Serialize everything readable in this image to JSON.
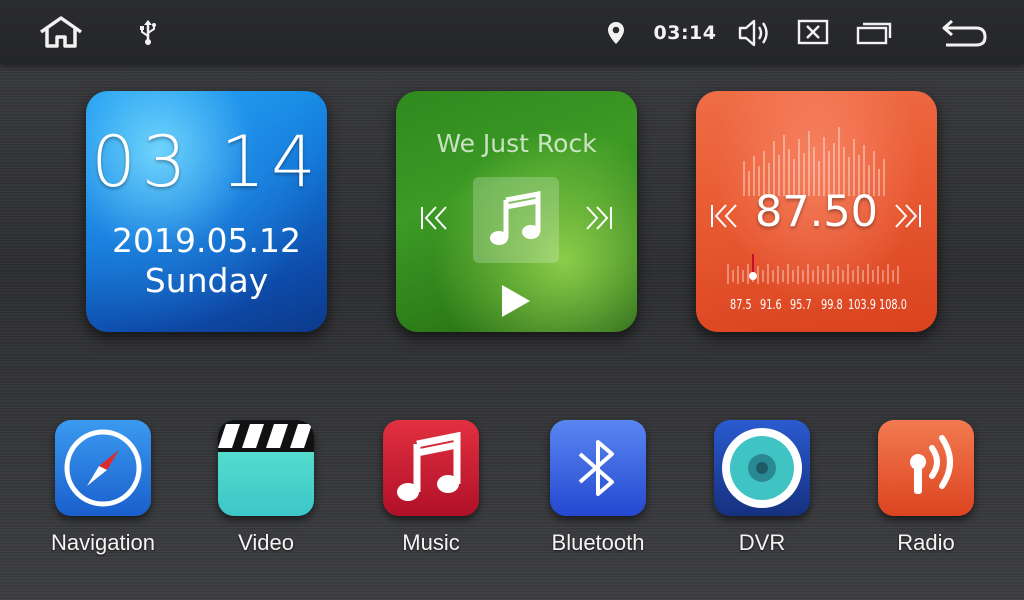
{
  "status_bar": {
    "home_icon": "home-icon",
    "usb_icon": "usb-icon",
    "location_icon": "location-pin-icon",
    "time": "03:14",
    "volume_icon": "volume-icon",
    "close_icon": "close-box-icon",
    "recents_icon": "recent-apps-icon",
    "back_icon": "back-icon"
  },
  "clock_widget": {
    "time": "03 14",
    "date": "2019.05.12",
    "day": "Sunday"
  },
  "music_widget": {
    "title": "We Just Rock",
    "icons": [
      "previous-icon",
      "music-note-icon",
      "next-icon",
      "play-icon"
    ]
  },
  "radio_widget": {
    "frequency": "87.50",
    "scale": [
      "87.5",
      "91.6",
      "95.7",
      "99.8",
      "103.9",
      "108.0"
    ],
    "tuning_position_fraction": 0.0
  },
  "apps": [
    {
      "label": "Navigation",
      "icon": "compass-icon",
      "color": "#1f6fd6"
    },
    {
      "label": "Video",
      "icon": "clapperboard-icon",
      "color": "#4fd8c0"
    },
    {
      "label": "Music",
      "icon": "music-note-icon",
      "color": "#c8182e"
    },
    {
      "label": "Bluetooth",
      "icon": "bluetooth-icon",
      "color": "#2f5fe0"
    },
    {
      "label": "DVR",
      "icon": "camera-lens-icon",
      "color": "#1a3f9c"
    },
    {
      "label": "Radio",
      "icon": "radio-antenna-icon",
      "color": "#e8552d"
    }
  ]
}
